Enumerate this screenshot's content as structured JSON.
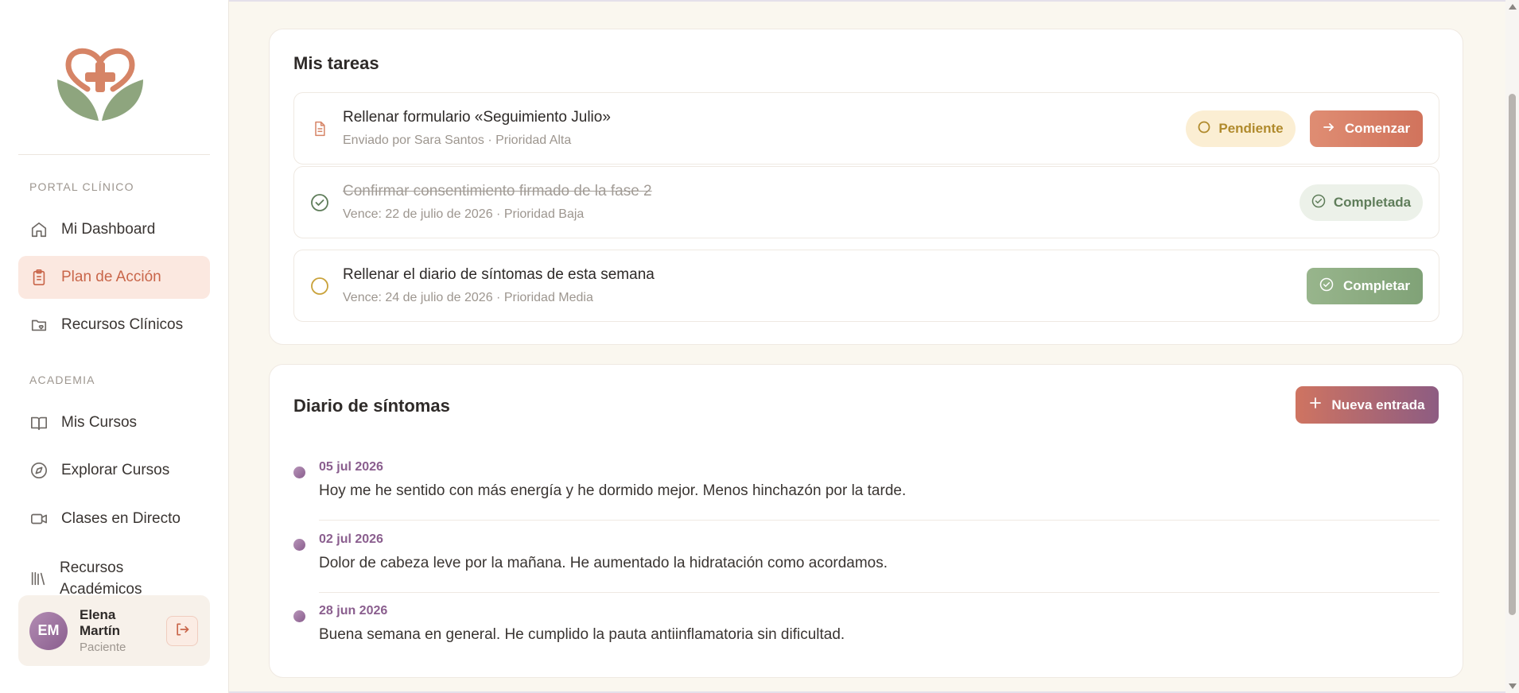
{
  "sidebar": {
    "sections": [
      {
        "title": "PORTAL CLÍNICO"
      },
      {
        "title": "ACADEMIA"
      }
    ],
    "items": [
      {
        "label": "Mi Dashboard",
        "icon": "home-icon"
      },
      {
        "label": "Plan de Acción",
        "icon": "clipboard-icon",
        "active": true
      },
      {
        "label": "Recursos Clínicos",
        "icon": "folder-heart-icon"
      },
      {
        "label": "Mis Cursos",
        "icon": "book-open-icon"
      },
      {
        "label": "Explorar Cursos",
        "icon": "compass-icon"
      },
      {
        "label": "Clases en Directo",
        "icon": "video-icon"
      },
      {
        "label": "Recursos Académicos",
        "icon": "library-icon"
      }
    ],
    "user": {
      "initials": "EM",
      "name": "Elena Martín",
      "role": "Paciente"
    }
  },
  "tasks": {
    "title": "Mis tareas",
    "items": [
      {
        "title": "Rellenar formulario «Seguimiento Julio»",
        "meta": "Enviado por Sara Santos · Prioridad Alta",
        "status_label": "Pendiente",
        "action_label": "Comenzar",
        "icon": "document-icon"
      },
      {
        "title": "Confirmar consentimiento firmado de la fase 2",
        "meta": "Vence: 22 de julio de 2026 · Prioridad Baja",
        "status_label": "Completada",
        "icon": "check-circle-icon"
      },
      {
        "title": "Rellenar el diario de síntomas de esta semana",
        "meta": "Vence: 24 de julio de 2026 · Prioridad Media",
        "action_label": "Completar",
        "icon": "circle-icon"
      }
    ]
  },
  "diary": {
    "title": "Diario de síntomas",
    "new_entry_label": "Nueva entrada",
    "entries": [
      {
        "date": "05 jul 2026",
        "text": "Hoy me he sentido con más energía y he dormido mejor. Menos hinchazón por la tarde."
      },
      {
        "date": "02 jul 2026",
        "text": "Dolor de cabeza leve por la mañana. He aumentado la hidratación como acordamos."
      },
      {
        "date": "28 jun 2026",
        "text": "Buena semana en general. He cumplido la pauta antiinflamatoria sin dificultad."
      }
    ]
  },
  "colors": {
    "accent": "#d1735c",
    "accent_bg": "#fbe8e0",
    "success": "#80a277",
    "pending": "#b08a2c",
    "purple": "#8a5e8e",
    "background": "#faf7ef"
  }
}
